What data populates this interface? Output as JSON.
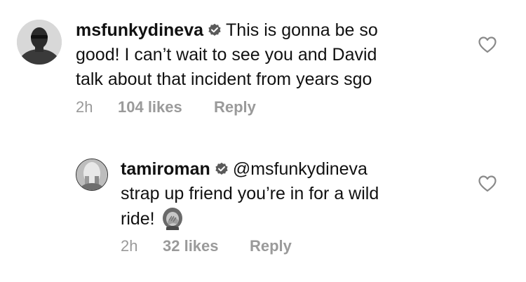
{
  "comments": [
    {
      "username": "msfunkydineva",
      "text_line1": "This is gonna be so",
      "text_line2": "good! I can’t wait to see you and David",
      "text_line3": "talk about that incident from years sgo",
      "time": "2h",
      "likes": "104 likes",
      "reply_label": "Reply"
    },
    {
      "username": "tamiroman",
      "mention": "@msfunkydineva",
      "text_line2": "strap up friend you’re in for a wild",
      "text_line3": "ride!",
      "emoji": "woman-facepalming-emoji",
      "time": "2h",
      "likes": "32 likes",
      "reply_label": "Reply"
    }
  ],
  "icons": {
    "verified": "verified-badge-icon",
    "like": "heart-outline-icon"
  },
  "colors": {
    "text": "#111111",
    "meta": "#9a9a9a",
    "background": "#ffffff"
  }
}
